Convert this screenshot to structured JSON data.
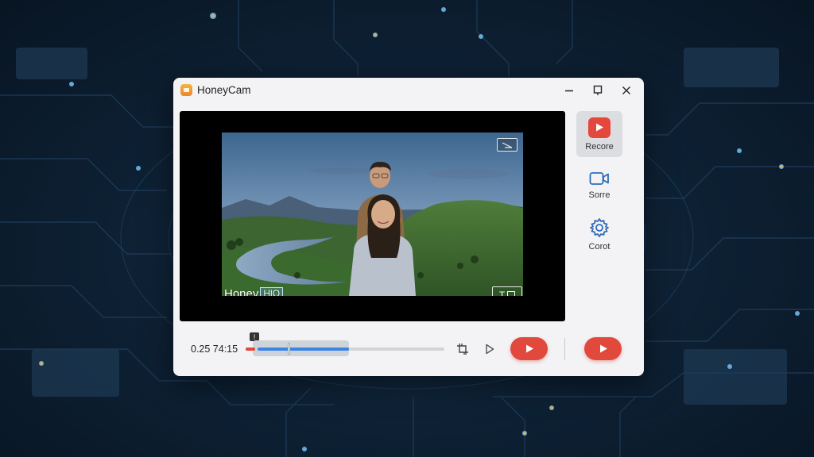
{
  "window": {
    "title": "HoneyCam",
    "controls": [
      "minimize",
      "pin",
      "close"
    ]
  },
  "preview": {
    "watermark_text": "Honey",
    "watermark_badge": "HlO",
    "caption_button_label": "T"
  },
  "sidebar": {
    "items": [
      {
        "label": "Recore",
        "icon": "record-icon",
        "active": true
      },
      {
        "label": "Sorre",
        "icon": "camera-icon",
        "active": false
      },
      {
        "label": "Corot",
        "icon": "gear-icon",
        "active": false
      }
    ]
  },
  "playback": {
    "time": "0.25 74:15",
    "marker": "!",
    "progress": 0.46
  },
  "colors": {
    "accent_red": "#e2493d",
    "progress_blue": "#3b86e0",
    "window_bg": "#f3f3f5"
  }
}
